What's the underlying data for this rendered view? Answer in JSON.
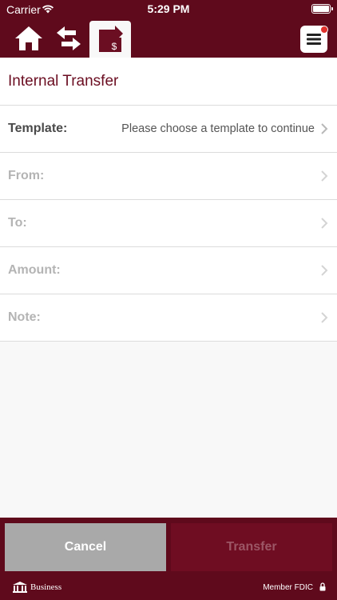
{
  "status_bar": {
    "carrier": "Carrier",
    "time": "5:29 PM"
  },
  "nav": {
    "items": [
      {
        "icon": "home-icon"
      },
      {
        "icon": "transfers-icon"
      },
      {
        "icon": "internal-transfer-icon",
        "active": true
      }
    ],
    "menu_icon": "hamburger-menu-icon",
    "notification": true
  },
  "page": {
    "title": "Internal Transfer"
  },
  "form": {
    "template": {
      "label": "Template:",
      "value": "Please choose a template to continue"
    },
    "from": {
      "label": "From:"
    },
    "to": {
      "label": "To:"
    },
    "amount": {
      "label": "Amount:"
    },
    "note": {
      "label": "Note:"
    }
  },
  "buttons": {
    "cancel": "Cancel",
    "transfer": "Transfer"
  },
  "footer": {
    "logo_text": "Business",
    "member": "Member FDIC"
  },
  "colors": {
    "brand": "#5f0a1c",
    "title": "#6b0e22",
    "cancel_bg": "#a9a9a9",
    "transfer_bg": "#6f0d22",
    "notification": "#e0302b"
  }
}
